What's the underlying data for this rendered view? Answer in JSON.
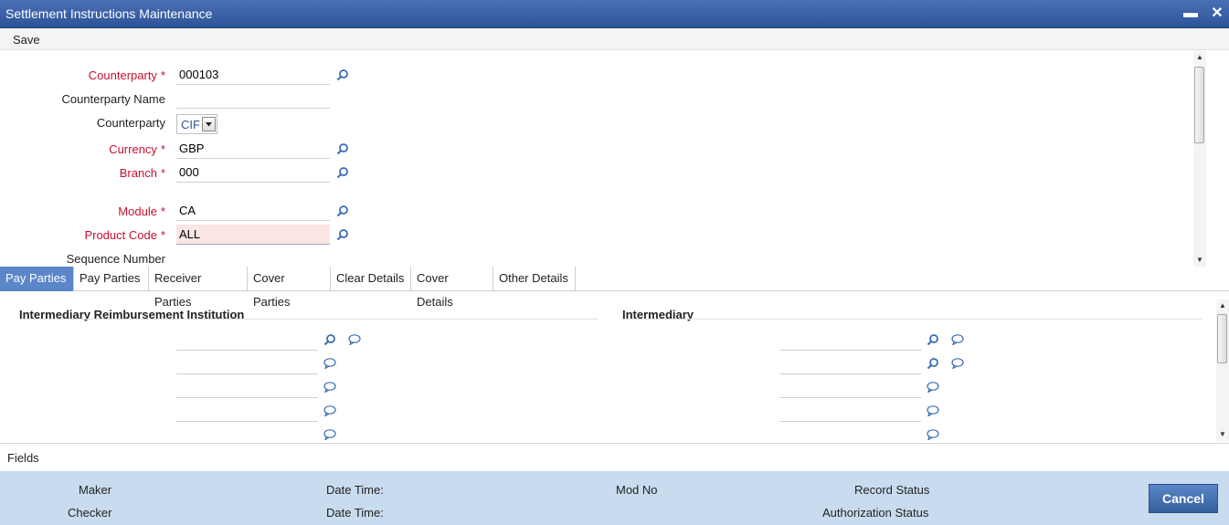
{
  "window": {
    "title": "Settlement Instructions Maintenance",
    "minimize": "▬",
    "close": "✕"
  },
  "toolbar": {
    "save_label": "Save"
  },
  "form": {
    "counterparty": {
      "label": "Counterparty",
      "value": "000103",
      "required": "*"
    },
    "counterparty_name": {
      "label": "Counterparty Name",
      "value": ""
    },
    "counterparty_type": {
      "label": "Counterparty",
      "value": "CIF"
    },
    "currency": {
      "label": "Currency",
      "value": "GBP",
      "required": "*"
    },
    "branch": {
      "label": "Branch",
      "value": "000",
      "required": "*"
    },
    "module": {
      "label": "Module",
      "value": "CA",
      "required": "*"
    },
    "product_code": {
      "label": "Product Code",
      "value": "ALL",
      "required": "*"
    },
    "sequence_number": {
      "label": "Sequence Number",
      "value": ""
    }
  },
  "tabs": [
    {
      "label": "Pay Parties"
    },
    {
      "label": "Pay Parties"
    },
    {
      "label": "Receiver Parties"
    },
    {
      "label": "Cover Parties"
    },
    {
      "label": "Clear Details"
    },
    {
      "label": "Cover Details"
    },
    {
      "label": "Other Details"
    }
  ],
  "panel": {
    "left_title": "Intermediary Reimbursement Institution",
    "right_title": "Intermediary"
  },
  "fields_label": "Fields",
  "footer": {
    "maker": "Maker",
    "checker": "Checker",
    "date_time_1": "Date Time:",
    "date_time_2": "Date Time:",
    "mod_no": "Mod No",
    "record_status": "Record Status",
    "authorization_status": "Authorization Status",
    "cancel_label": "Cancel"
  },
  "colors": {
    "titlebar": "#2d5397",
    "active_tab": "#5b86c9",
    "required_label": "#c8102e",
    "footer": "#c9dcef"
  }
}
